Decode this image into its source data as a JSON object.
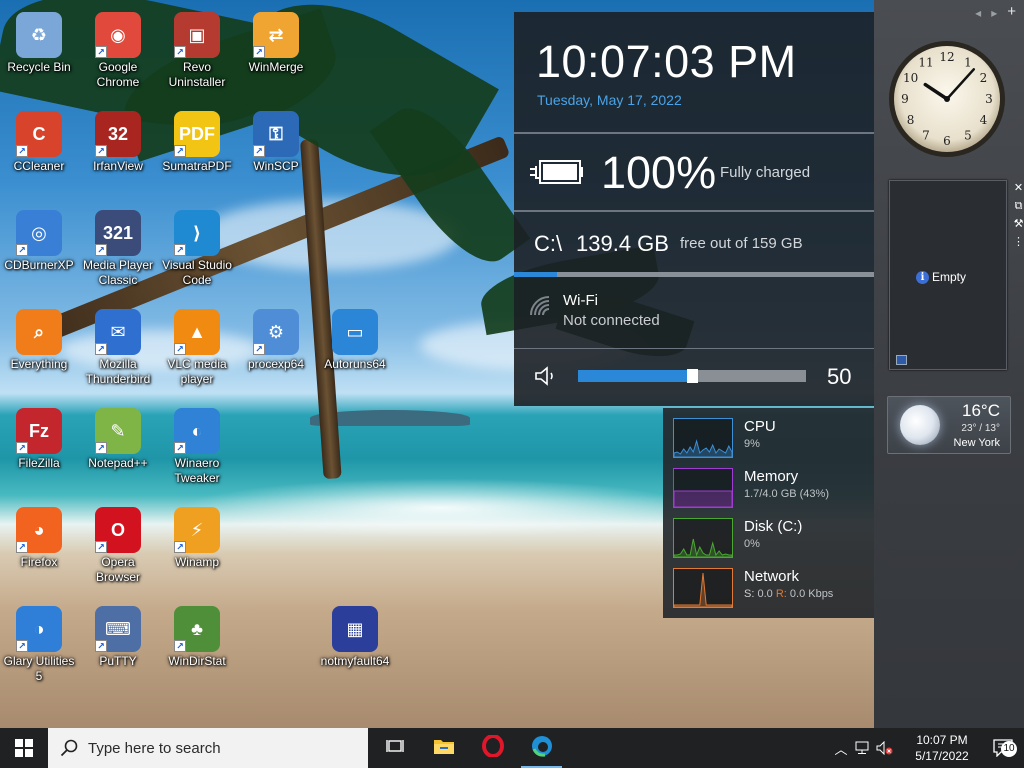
{
  "desktop": {
    "icons": [
      {
        "label": "Recycle Bin",
        "icon": "recycle-bin-icon",
        "color": "#7aa7d8",
        "glyph": "♻",
        "shortcut": false
      },
      {
        "label": "Google Chrome",
        "icon": "chrome-icon",
        "color": "#e0493b",
        "glyph": "◉",
        "shortcut": true
      },
      {
        "label": "Revo Uninstaller",
        "icon": "revo-uninstaller-icon",
        "color": "#b53a2f",
        "glyph": "▣",
        "shortcut": true
      },
      {
        "label": "WinMerge",
        "icon": "winmerge-icon",
        "color": "#f0a431",
        "glyph": "⇄",
        "shortcut": true
      },
      {
        "label": "CCleaner",
        "icon": "ccleaner-icon",
        "color": "#d8432b",
        "glyph": "C",
        "shortcut": true
      },
      {
        "label": "IrfanView",
        "icon": "irfanview-icon",
        "color": "#a8261f",
        "glyph": "32",
        "shortcut": true
      },
      {
        "label": "SumatraPDF",
        "icon": "sumatrapdf-icon",
        "color": "#f2c514",
        "glyph": "PDF",
        "shortcut": true
      },
      {
        "label": "WinSCP",
        "icon": "winscp-icon",
        "color": "#2c6ab8",
        "glyph": "⚿",
        "shortcut": true
      },
      {
        "label": "CDBurnerXP",
        "icon": "cdburnerxp-icon",
        "color": "#3a7fd6",
        "glyph": "◎",
        "shortcut": true
      },
      {
        "label": "Media Player Classic",
        "icon": "media-player-classic-icon",
        "color": "#3b4c7a",
        "glyph": "321",
        "shortcut": true
      },
      {
        "label": "Visual Studio Code",
        "icon": "vscode-icon",
        "color": "#1f8ad2",
        "glyph": "⟩",
        "shortcut": true
      },
      {
        "label": "Everything",
        "icon": "everything-icon",
        "color": "#f07d1a",
        "glyph": "⌕",
        "shortcut": false
      },
      {
        "label": "Mozilla Thunderbird",
        "icon": "thunderbird-icon",
        "color": "#2f6fd0",
        "glyph": "✉",
        "shortcut": true
      },
      {
        "label": "VLC media player",
        "icon": "vlc-icon",
        "color": "#f08a10",
        "glyph": "▲",
        "shortcut": true
      },
      {
        "label": "procexp64",
        "icon": "procexp-icon",
        "color": "#4f8ed6",
        "glyph": "⚙",
        "shortcut": true
      },
      {
        "label": "Autoruns64",
        "icon": "autoruns-icon",
        "color": "#2c86d8",
        "glyph": "▭",
        "shortcut": false
      },
      {
        "label": "FileZilla",
        "icon": "filezilla-icon",
        "color": "#c4262d",
        "glyph": "Fz",
        "shortcut": true
      },
      {
        "label": "Notepad++",
        "icon": "notepadpp-icon",
        "color": "#7fb546",
        "glyph": "✎",
        "shortcut": true
      },
      {
        "label": "Winaero Tweaker",
        "icon": "winaero-tweaker-icon",
        "color": "#2f82d6",
        "glyph": "◐",
        "shortcut": true
      },
      {
        "label": "Firefox",
        "icon": "firefox-icon",
        "color": "#f2631f",
        "glyph": "◕",
        "shortcut": true
      },
      {
        "label": "Opera Browser",
        "icon": "opera-icon",
        "color": "#d3121f",
        "glyph": "O",
        "shortcut": true
      },
      {
        "label": "Winamp",
        "icon": "winamp-icon",
        "color": "#f0a020",
        "glyph": "⚡",
        "shortcut": true
      },
      {
        "label": "Glary Utilities 5",
        "icon": "glary-utilities-icon",
        "color": "#2f7fd8",
        "glyph": "◑",
        "shortcut": true
      },
      {
        "label": "PuTTY",
        "icon": "putty-icon",
        "color": "#4d6fa6",
        "glyph": "⌨",
        "shortcut": true
      },
      {
        "label": "WinDirStat",
        "icon": "windirstat-icon",
        "color": "#4f8f3a",
        "glyph": "♣",
        "shortcut": true
      },
      {
        "label": "notmyfault64",
        "icon": "notmyfault-icon",
        "color": "#2b3f9a",
        "glyph": "▦",
        "shortcut": false
      }
    ]
  },
  "flyout": {
    "time": "10:07:03 PM",
    "date": "Tuesday, May 17, 2022",
    "battery": {
      "percent": "100%",
      "status": "Fully charged",
      "level": 1.0
    },
    "disk": {
      "path": "C:\\",
      "free": "139.4 GB",
      "of": "free out of 159 GB",
      "used_fraction": 0.12
    },
    "wifi": {
      "name": "Wi-Fi",
      "state": "Not connected"
    },
    "volume": {
      "value": "50",
      "level": 0.5
    }
  },
  "performance": [
    {
      "name": "CPU",
      "value": "9%",
      "color": "#3d8fd6",
      "points": [
        34,
        33,
        35,
        30,
        34,
        28,
        33,
        22,
        34,
        31,
        29,
        33,
        26,
        34,
        30,
        32,
        34,
        27,
        33
      ]
    },
    {
      "name": "Memory",
      "value": "1.7/4.0 GB (43%)",
      "color": "#a23bd3",
      "points": [
        22,
        22,
        22,
        22,
        22,
        22,
        22,
        22,
        22,
        22,
        22,
        22,
        22,
        22,
        22,
        22,
        22,
        22,
        22
      ]
    },
    {
      "name": "Disk (C:)",
      "value": "0%",
      "color": "#4aa832",
      "points": [
        36,
        36,
        35,
        30,
        36,
        36,
        20,
        36,
        28,
        34,
        36,
        36,
        24,
        36,
        32,
        36,
        35,
        36,
        36
      ]
    },
    {
      "name": "Network",
      "value_s_label": "S:",
      "value_s": "0.0",
      "value_r_label": "R:",
      "value_r": "0.0 Kbps",
      "color": "#e07a35",
      "points": [
        36,
        36,
        36,
        36,
        36,
        36,
        36,
        36,
        36,
        4,
        36,
        36,
        36,
        36,
        36,
        36,
        36,
        36,
        36
      ]
    }
  ],
  "sidebar": {
    "slideshow_text": "Empty",
    "weather": {
      "temp": "16°C",
      "range": "23° / 13°",
      "city": "New York"
    },
    "clock": {
      "hour": 10,
      "minute": 7
    }
  },
  "taskbar": {
    "search_placeholder": "Type here to search",
    "apps": [
      {
        "icon": "task-view-icon",
        "running": false
      },
      {
        "icon": "file-explorer-icon",
        "running": false
      },
      {
        "icon": "opera-icon",
        "running": false
      },
      {
        "icon": "edge-icon",
        "running": true
      }
    ],
    "clock_time": "10:07 PM",
    "clock_date": "5/17/2022",
    "notification_count": "10"
  }
}
